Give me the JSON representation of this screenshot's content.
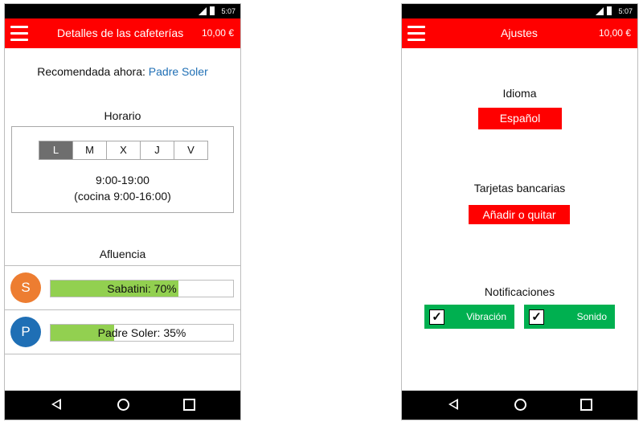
{
  "status_bar": {
    "time": "5:07"
  },
  "left_screen": {
    "title": "Detalles de las cafeterías",
    "balance": "10,00 €",
    "recommended_label": "Recomendada ahora:",
    "recommended_name": "Padre Soler",
    "schedule_title": "Horario",
    "days": [
      "L",
      "M",
      "X",
      "J",
      "V"
    ],
    "selected_day": "L",
    "hours_line1": "9:00-19:00",
    "hours_line2": "(cocina 9:00-16:00)",
    "crowd_title": "Afluencia",
    "crowd": [
      {
        "initial": "S",
        "label": "Sabatini: 70%",
        "percent": 70,
        "color": "#ed7d31"
      },
      {
        "initial": "P",
        "label": "Padre Soler: 35%",
        "percent": 35,
        "color": "#1f6fb5"
      }
    ]
  },
  "right_screen": {
    "title": "Ajustes",
    "balance": "10,00 €",
    "language_title": "Idioma",
    "language_button": "Español",
    "cards_title": "Tarjetas bancarias",
    "cards_button": "Añadir o quitar",
    "notifications_title": "Notificaciones",
    "vibration_label": "Vibración",
    "vibration_checked": "✓",
    "sound_label": "Sonido",
    "sound_checked": "✓"
  },
  "icons": {
    "menu": "hamburger-icon",
    "back": "back-triangle-icon",
    "home": "home-circle-icon",
    "recent": "recent-square-icon",
    "signal": "signal-icon",
    "battery": "battery-icon"
  },
  "colors": {
    "accent_red": "#ff0000",
    "progress_green": "#92d050",
    "toggle_green": "#00b050",
    "link_blue": "#1f6fb5"
  }
}
